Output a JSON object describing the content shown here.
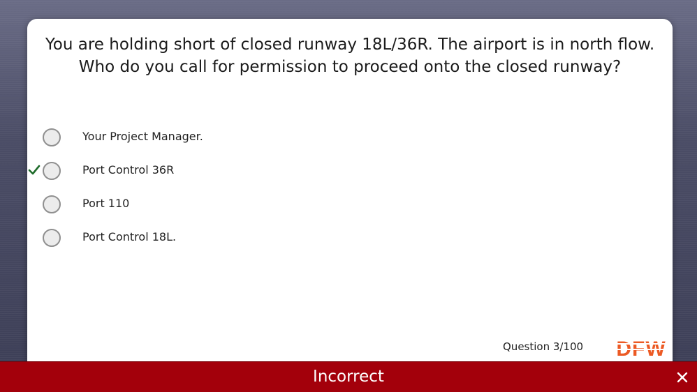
{
  "quiz": {
    "question_text": "You are holding short of closed runway 18L/36R.  The airport is in north flow.  Who do you call for permission to proceed onto the closed runway?",
    "options": [
      {
        "label": "Your Project Manager.",
        "selected": false,
        "correct": false
      },
      {
        "label": "Port Control 36R",
        "selected": false,
        "correct": true
      },
      {
        "label": "Port 110",
        "selected": false,
        "correct": false
      },
      {
        "label": "Port Control 18L.",
        "selected": false,
        "correct": false
      }
    ],
    "progress_text": "Question 3/100"
  },
  "brand": {
    "logo_text": "DFW",
    "logo_color": "#ec5a24"
  },
  "feedback": {
    "status_text": "Incorrect",
    "bar_color": "#a3000b"
  },
  "icons": {
    "correct_marker": "checkmark-icon",
    "close": "close-icon"
  },
  "colors": {
    "check_green": "#1e6b2a",
    "background": "#4b4d66"
  }
}
